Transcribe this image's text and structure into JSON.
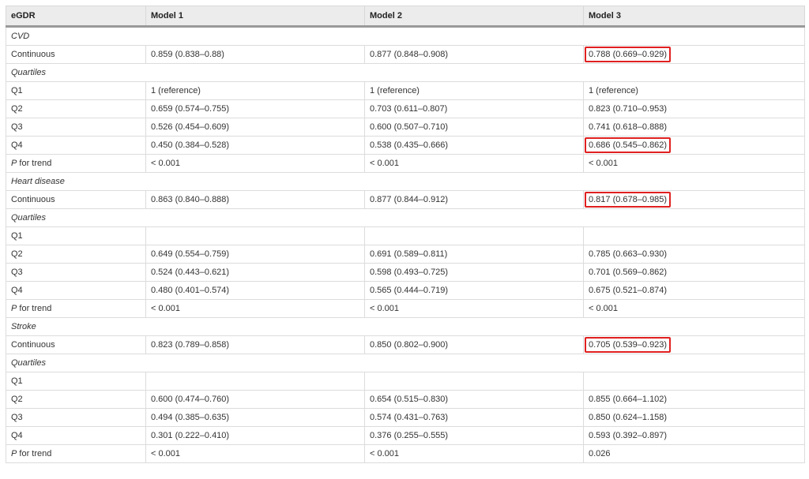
{
  "table": {
    "headers": [
      "eGDR",
      "Model 1",
      "Model 2",
      "Model 3"
    ],
    "sections": {
      "cvd": {
        "title": "CVD",
        "continuous": [
          "Continuous",
          "0.859 (0.838–0.88)",
          "0.877 (0.848–0.908)",
          "0.788 (0.669–0.929)"
        ],
        "quartiles_title": "Quartiles",
        "q1": [
          "Q1",
          "1 (reference)",
          "1 (reference)",
          "1 (reference)"
        ],
        "q2": [
          "Q2",
          "0.659 (0.574–0.755)",
          "0.703 (0.611–0.807)",
          "0.823 (0.710–0.953)"
        ],
        "q3": [
          "Q3",
          "0.526 (0.454–0.609)",
          "0.600 (0.507–0.710)",
          "0.741 (0.618–0.888)"
        ],
        "q4": [
          "Q4",
          "0.450 (0.384–0.528)",
          "0.538 (0.435–0.666)",
          "0.686 (0.545–0.862)"
        ],
        "trend": [
          "P",
          " for trend",
          "< 0.001",
          "< 0.001",
          "< 0.001"
        ]
      },
      "heart": {
        "title": "Heart disease",
        "continuous": [
          "Continuous",
          "0.863 (0.840–0.888)",
          "0.877 (0.844–0.912)",
          "0.817 (0.678–0.985)"
        ],
        "quartiles_title": "Quartiles",
        "q1": [
          "Q1",
          "",
          "",
          ""
        ],
        "q2": [
          "Q2",
          "0.649 (0.554–0.759)",
          "0.691 (0.589–0.811)",
          "0.785 (0.663–0.930)"
        ],
        "q3": [
          "Q3",
          "0.524 (0.443–0.621)",
          "0.598 (0.493–0.725)",
          "0.701 (0.569–0.862)"
        ],
        "q4": [
          "Q4",
          "0.480 (0.401–0.574)",
          "0.565 (0.444–0.719)",
          "0.675 (0.521–0.874)"
        ],
        "trend": [
          "P",
          " for trend",
          "< 0.001",
          "< 0.001",
          "< 0.001"
        ]
      },
      "stroke": {
        "title": "Stroke",
        "continuous": [
          "Continuous",
          "0.823 (0.789–0.858)",
          "0.850 (0.802–0.900)",
          "0.705 (0.539–0.923)"
        ],
        "quartiles_title": "Quartiles",
        "q1": [
          "Q1",
          "",
          "",
          ""
        ],
        "q2": [
          "Q2",
          "0.600 (0.474–0.760)",
          "0.654 (0.515–0.830)",
          "0.855 (0.664–1.102)"
        ],
        "q3": [
          "Q3",
          "0.494 (0.385–0.635)",
          "0.574 (0.431–0.763)",
          "0.850 (0.624–1.158)"
        ],
        "q4": [
          "Q4",
          "0.301 (0.222–0.410)",
          "0.376 (0.255–0.555)",
          "0.593 (0.392–0.897)"
        ],
        "trend": [
          "P",
          " for trend",
          "< 0.001",
          "< 0.001",
          "0.026"
        ]
      }
    }
  },
  "highlight_color": "#e02020"
}
